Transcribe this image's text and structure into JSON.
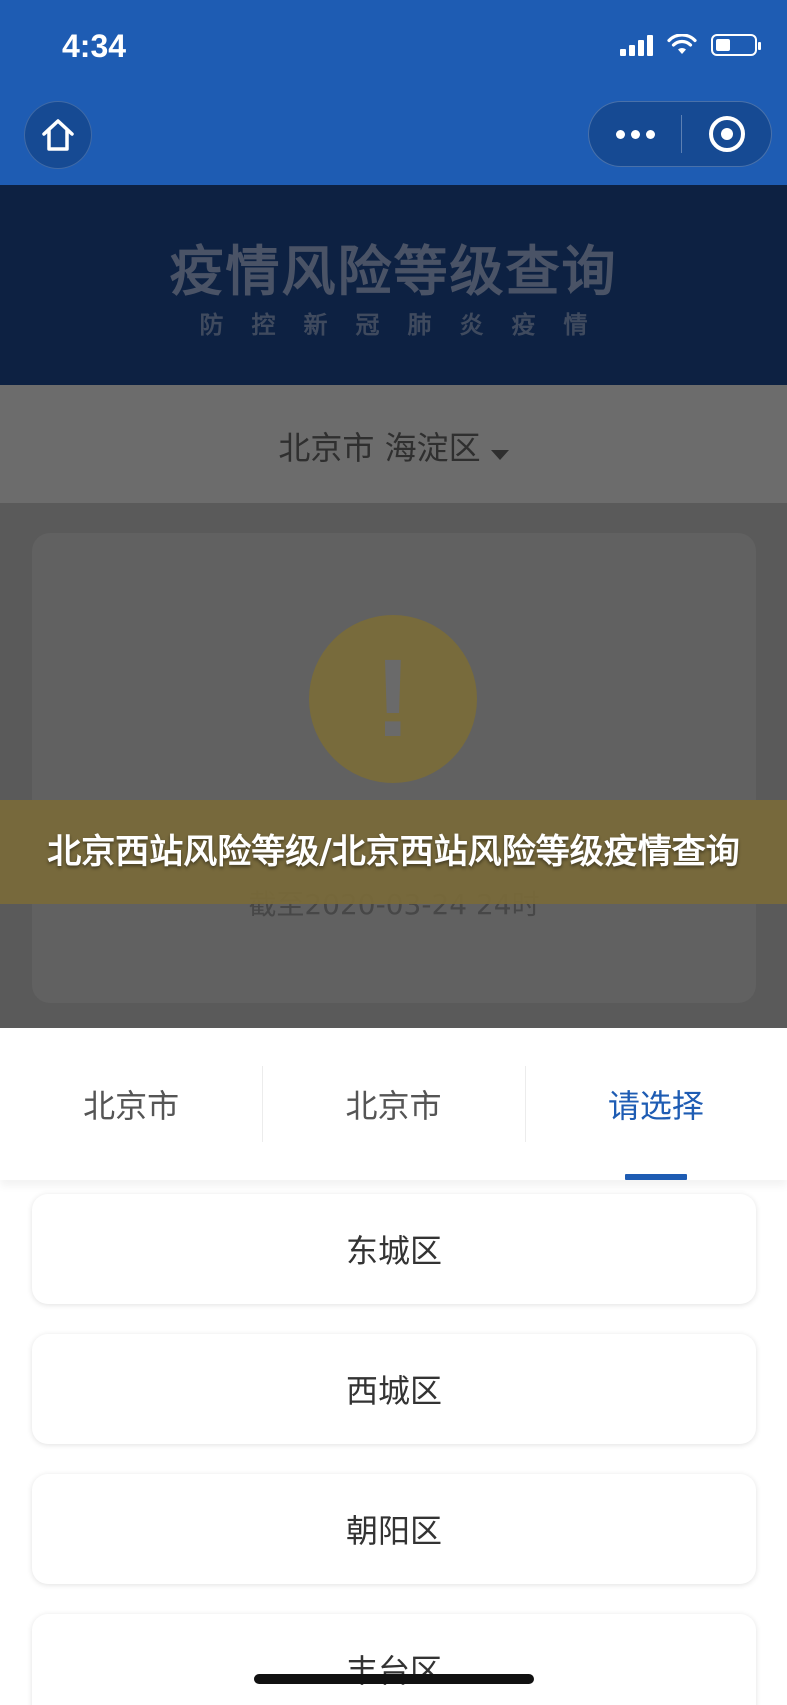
{
  "status_bar": {
    "time": "4:34"
  },
  "nav": {
    "home_icon": "home-icon",
    "more_icon": "more-dots-icon",
    "close_icon": "target-icon"
  },
  "background_page": {
    "banner_title": "疫情风险等级查询",
    "banner_subtitle": "防控新冠肺炎疫情",
    "region_selector": "北京市 海淀区",
    "warning_icon": "exclamation-icon",
    "date_text": "截至2020-03-24 24时"
  },
  "overlay_title": "北京西站风险等级/北京西站风险等级疫情查询",
  "picker": {
    "tabs": [
      {
        "label": "北京市"
      },
      {
        "label": "北京市"
      },
      {
        "label": "请选择"
      }
    ],
    "active_tab_color": "#1e5cb3",
    "options": [
      {
        "label": "东城区"
      },
      {
        "label": "西城区"
      },
      {
        "label": "朝阳区"
      },
      {
        "label": "丰台区"
      }
    ]
  },
  "colors": {
    "brand_blue": "#1e5cb3",
    "banner_navy": "#0d2142",
    "warning_yellow": "#786b3c"
  }
}
